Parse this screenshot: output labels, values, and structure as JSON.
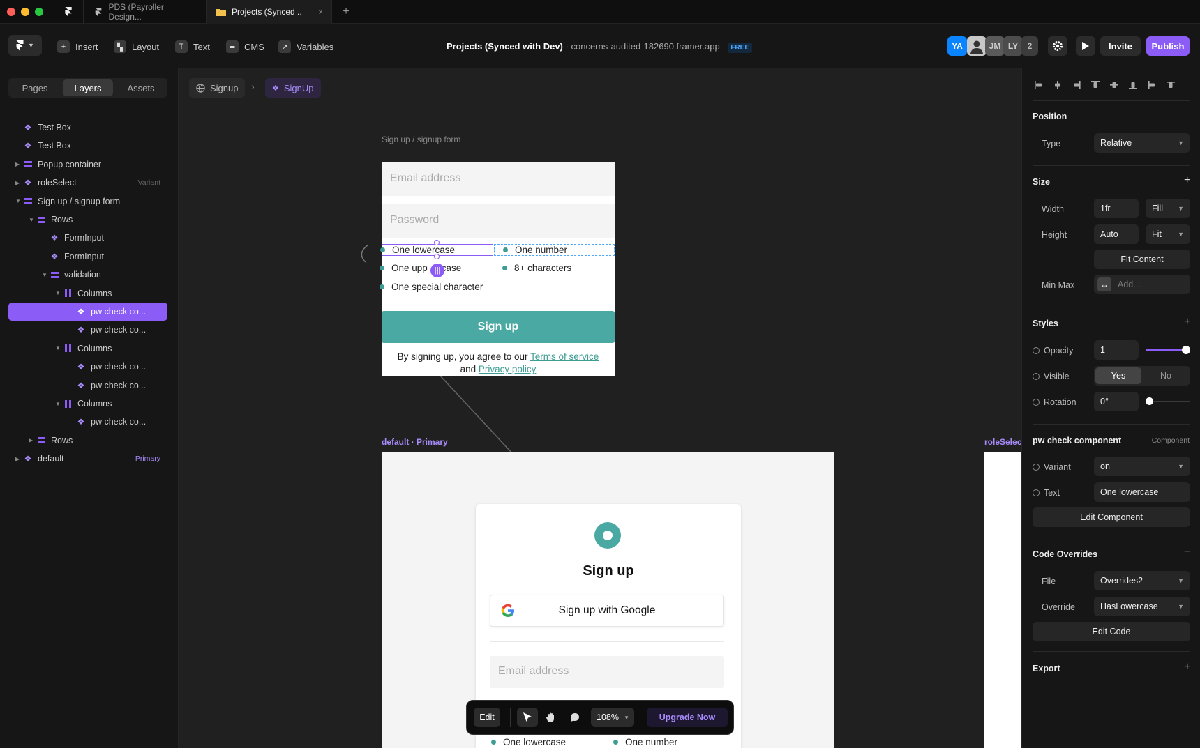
{
  "tabs": [
    {
      "label": "PDS (Payroller Design..."
    },
    {
      "label": "Projects (Synced ..",
      "close": "×"
    }
  ],
  "new_tab": "+",
  "toolbar": {
    "insert": "Insert",
    "layout": "Layout",
    "text": "Text",
    "cms": "CMS",
    "variables": "Variables",
    "project_title": "Projects (Synced with Dev)",
    "separator": "·",
    "domain": "concerns-audited-182690.framer.app",
    "plan": "FREE",
    "avatars": [
      "YA",
      "JM",
      "LY",
      "2"
    ],
    "invite": "Invite",
    "publish": "Publish"
  },
  "left_panel": {
    "tabs": [
      "Pages",
      "Layers",
      "Assets"
    ],
    "active_tab": "Layers",
    "layers": [
      {
        "name": "Test Box",
        "icon": "component",
        "depth": 0,
        "expand": ""
      },
      {
        "name": "Test Box",
        "icon": "component",
        "depth": 0,
        "expand": ""
      },
      {
        "name": "Popup container",
        "icon": "stack",
        "depth": 0,
        "expand": "collapsed"
      },
      {
        "name": "roleSelect",
        "icon": "component",
        "depth": 0,
        "expand": "collapsed",
        "tag": "Variant"
      },
      {
        "name": "Sign up / signup form",
        "icon": "stack",
        "depth": 0,
        "expand": "expanded"
      },
      {
        "name": "Rows",
        "icon": "stack",
        "depth": 1,
        "expand": "expanded"
      },
      {
        "name": "FormInput",
        "icon": "component",
        "depth": 2,
        "expand": ""
      },
      {
        "name": "FormInput",
        "icon": "component",
        "depth": 2,
        "expand": ""
      },
      {
        "name": "validation",
        "icon": "stack",
        "depth": 2,
        "expand": "expanded"
      },
      {
        "name": "Columns",
        "icon": "columns",
        "depth": 3,
        "expand": "expanded"
      },
      {
        "name": "pw check co...",
        "icon": "component",
        "depth": 4,
        "expand": "",
        "selected": true
      },
      {
        "name": "pw check co...",
        "icon": "component",
        "depth": 4,
        "expand": ""
      },
      {
        "name": "Columns",
        "icon": "columns",
        "depth": 3,
        "expand": "expanded"
      },
      {
        "name": "pw check co...",
        "icon": "component",
        "depth": 4,
        "expand": ""
      },
      {
        "name": "pw check co...",
        "icon": "component",
        "depth": 4,
        "expand": ""
      },
      {
        "name": "Columns",
        "icon": "columns",
        "depth": 3,
        "expand": "expanded"
      },
      {
        "name": "pw check co...",
        "icon": "component",
        "depth": 4,
        "expand": ""
      },
      {
        "name": "Rows",
        "icon": "stack",
        "depth": 1,
        "expand": "collapsed"
      },
      {
        "name": "default",
        "icon": "component",
        "depth": 0,
        "expand": "collapsed",
        "tag": "Primary"
      }
    ]
  },
  "canvas": {
    "breadcrumb": [
      "Signup",
      "SignUp"
    ],
    "breadcrumb_sep": "›",
    "frame1_label": "Sign up / signup form",
    "email_placeholder": "Email address",
    "password_placeholder": "Password",
    "checks": [
      "One lowercase",
      "One number",
      "One uppercase",
      "8+ characters",
      "One special character"
    ],
    "check_partial_left": "One upp",
    "check_partial_right": "case",
    "signup_button": "Sign up",
    "terms_prefix": "By signing up, you agree to our",
    "terms_link": "Terms of service",
    "terms_and": "and",
    "privacy_link": "Privacy policy",
    "frame2_label": "default · Primary",
    "frame3_label": "roleSelec",
    "card_title": "Sign up",
    "google_button": "Sign up with Google",
    "card_email_placeholder": "Email address",
    "card_checks": [
      "One lowercase",
      "One number"
    ]
  },
  "floating_toolbar": {
    "edit": "Edit",
    "zoom": "108%",
    "upgrade": "Upgrade Now"
  },
  "right_panel": {
    "position": {
      "title": "Position",
      "type_label": "Type",
      "type_value": "Relative"
    },
    "size": {
      "title": "Size",
      "width_label": "Width",
      "width_value": "1fr",
      "width_mode": "Fill",
      "height_label": "Height",
      "height_value": "Auto",
      "height_mode": "Fit",
      "fit_content": "Fit Content",
      "minmax_label": "Min Max",
      "minmax_placeholder": "Add..."
    },
    "styles": {
      "title": "Styles",
      "opacity_label": "Opacity",
      "opacity_value": "1",
      "visible_label": "Visible",
      "visible_yes": "Yes",
      "visible_no": "No",
      "rotation_label": "Rotation",
      "rotation_value": "0°"
    },
    "component": {
      "title": "pw check component",
      "tag": "Component",
      "variant_label": "Variant",
      "variant_value": "on",
      "text_label": "Text",
      "text_value": "One lowercase",
      "edit_component": "Edit Component"
    },
    "code_overrides": {
      "title": "Code Overrides",
      "file_label": "File",
      "file_value": "Overrides2",
      "override_label": "Override",
      "override_value": "HasLowercase",
      "edit_code": "Edit Code"
    },
    "export": {
      "title": "Export"
    }
  },
  "colors": {
    "accent": "#8b5cf6",
    "teal": "#4ba9a4",
    "canvas": "#202020",
    "panel": "#161616"
  }
}
